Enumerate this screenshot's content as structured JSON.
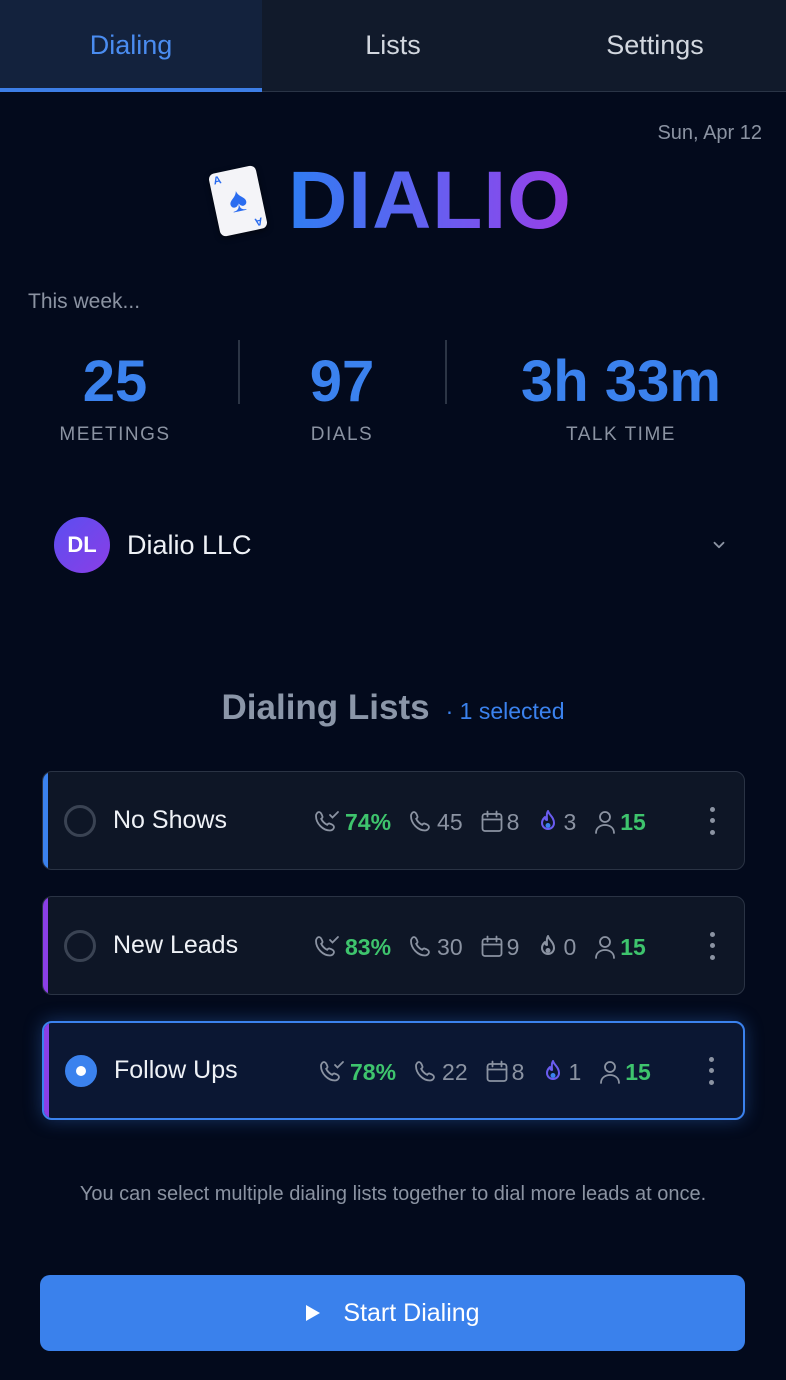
{
  "tabs": [
    {
      "label": "Dialing",
      "active": true
    },
    {
      "label": "Lists",
      "active": false
    },
    {
      "label": "Settings",
      "active": false
    }
  ],
  "date": "Sun, Apr 12",
  "brand": {
    "name": "DIALIO",
    "icon": "spade-card-icon"
  },
  "week_label": "This week...",
  "stats": [
    {
      "value": "25",
      "label": "MEETINGS"
    },
    {
      "value": "97",
      "label": "DIALS"
    },
    {
      "value": "3h 33m",
      "label": "TALK TIME"
    }
  ],
  "org": {
    "initials": "DL",
    "name": "Dialio LLC"
  },
  "section": {
    "title": "Dialing Lists",
    "selected_text": "· 1 selected"
  },
  "lists": [
    {
      "name": "No Shows",
      "selected": false,
      "accent": "#3b82ee",
      "connect_rate": "74%",
      "calls": "45",
      "meetings": "8",
      "hot": "3",
      "hot_active": true,
      "contacts": "15"
    },
    {
      "name": "New Leads",
      "selected": false,
      "accent": "#8b3fe6",
      "connect_rate": "83%",
      "calls": "30",
      "meetings": "9",
      "hot": "0",
      "hot_active": false,
      "contacts": "15"
    },
    {
      "name": "Follow Ups",
      "selected": true,
      "accent": "#8b3fe6",
      "connect_rate": "78%",
      "calls": "22",
      "meetings": "8",
      "hot": "1",
      "hot_active": true,
      "contacts": "15"
    }
  ],
  "hint": "You can select multiple dialing lists together to dial more leads at once.",
  "start_button": {
    "label": "Start Dialing"
  },
  "colors": {
    "accent": "#3b82ee",
    "green": "#3ec46d",
    "purple": "#8b3fe6",
    "background": "#030a1c"
  }
}
